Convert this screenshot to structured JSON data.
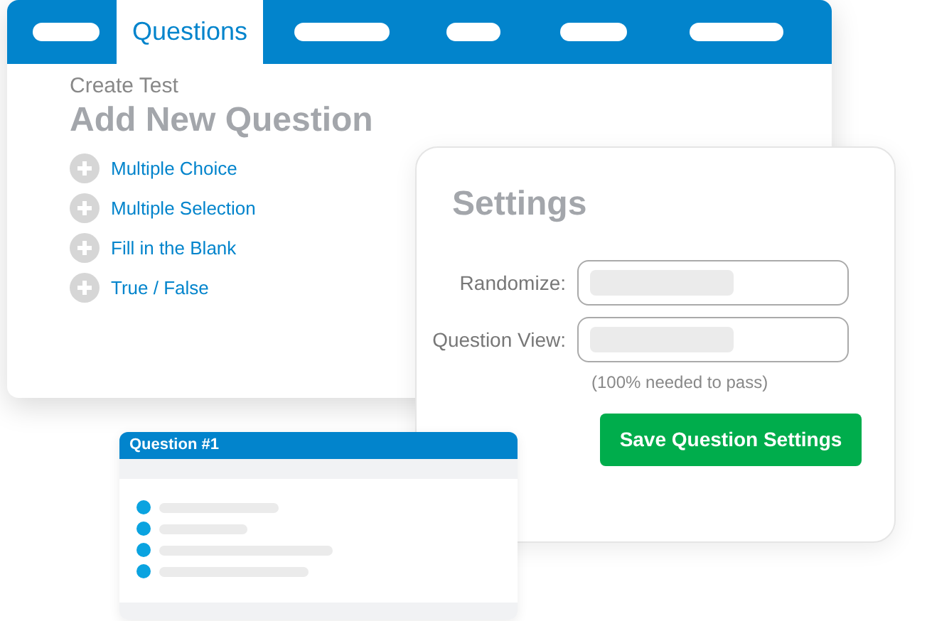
{
  "tabs": [
    {
      "kind": "placeholder",
      "selected": false
    },
    {
      "kind": "text",
      "label": "Questions",
      "selected": true
    },
    {
      "kind": "placeholder",
      "selected": false
    },
    {
      "kind": "placeholder",
      "selected": false
    },
    {
      "kind": "placeholder",
      "selected": false
    },
    {
      "kind": "placeholder",
      "selected": false
    }
  ],
  "breadcrumb": "Create Test",
  "heading": "Add New Question",
  "question_types": [
    "Multiple Choice",
    "Multiple Selection",
    "Fill in the Blank",
    "True / False"
  ],
  "settings": {
    "title": "Settings",
    "fields": [
      {
        "label": "Randomize:"
      },
      {
        "label": "Question View:"
      }
    ],
    "hint": "(100% needed to pass)",
    "save_button": "Save Question Settings"
  },
  "question_card": {
    "title": "Question #1"
  }
}
